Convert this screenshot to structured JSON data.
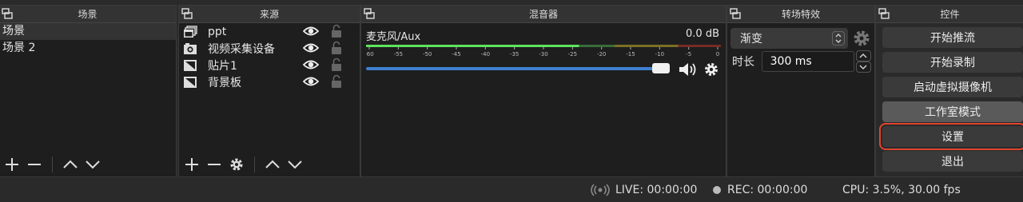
{
  "scenes": {
    "title": "场景",
    "items": [
      "场景",
      "场景 2"
    ],
    "selected_index": 0
  },
  "sources": {
    "title": "来源",
    "items": [
      {
        "label": "ppt",
        "icon": "window-capture-icon"
      },
      {
        "label": "视频采集设备",
        "icon": "camera-icon"
      },
      {
        "label": "贴片1",
        "icon": "image-icon"
      },
      {
        "label": "背景板",
        "icon": "image-icon"
      }
    ]
  },
  "mixer": {
    "title": "混音器",
    "channel_name": "麦克风/Aux",
    "db_value": "0.0 dB",
    "scale_labels": [
      "-60",
      "-55",
      "-50",
      "-45",
      "-40",
      "-35",
      "-30",
      "-25",
      "-20",
      "-15",
      "-10",
      "-5",
      "0"
    ],
    "volume_fraction": 1.0
  },
  "transitions": {
    "title": "转场特效",
    "selected": "渐变",
    "duration_label": "时长",
    "duration_value": "300 ms"
  },
  "controls": {
    "title": "控件",
    "buttons": [
      "开始推流",
      "开始录制",
      "启动虚拟摄像机",
      "工作室模式",
      "设置",
      "退出"
    ],
    "active_index": 3,
    "highlight_index": 4
  },
  "status": {
    "live": "LIVE: 00:00:00",
    "rec": "REC: 00:00:00",
    "cpu": "CPU: 3.5%, 30.00 fps"
  },
  "colors": {
    "accent_blue": "#3f7fd1",
    "highlight_red": "#e0442f",
    "meter_green": "#4caf50",
    "meter_yellow": "#c9b22a",
    "meter_red": "#c0392b"
  }
}
